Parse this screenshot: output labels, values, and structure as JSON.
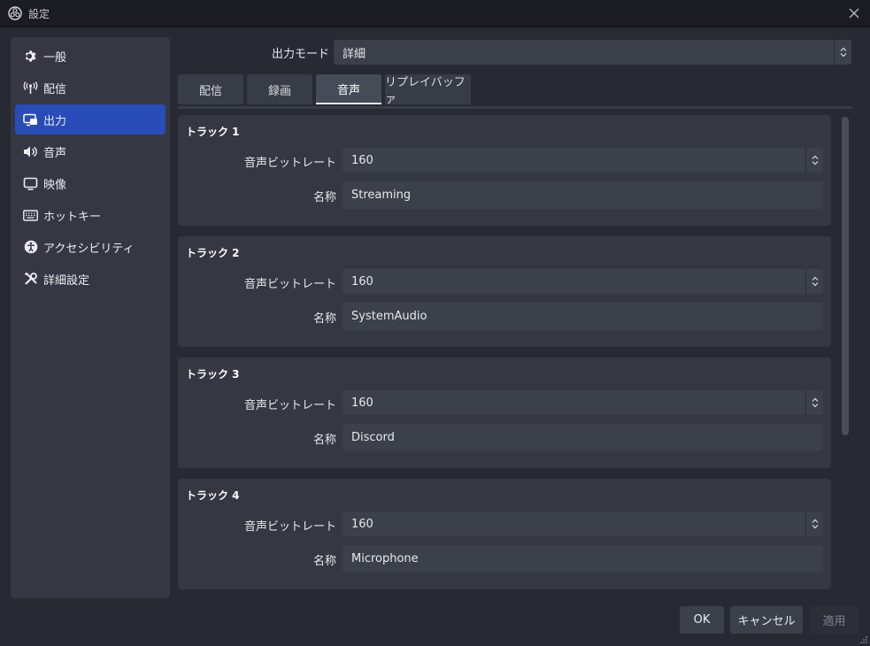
{
  "window": {
    "title": "設定"
  },
  "sidebar": {
    "items": [
      {
        "label": "一般",
        "icon": "gear-icon",
        "active": false
      },
      {
        "label": "配信",
        "icon": "broadcast-icon",
        "active": false
      },
      {
        "label": "出力",
        "icon": "output-icon",
        "active": true
      },
      {
        "label": "音声",
        "icon": "speaker-icon",
        "active": false
      },
      {
        "label": "映像",
        "icon": "monitor-icon",
        "active": false
      },
      {
        "label": "ホットキー",
        "icon": "keyboard-icon",
        "active": false
      },
      {
        "label": "アクセシビリティ",
        "icon": "accessibility-icon",
        "active": false
      },
      {
        "label": "詳細設定",
        "icon": "tools-icon",
        "active": false
      }
    ]
  },
  "output_mode": {
    "label": "出力モード",
    "value": "詳細"
  },
  "tabs": [
    {
      "label": "配信",
      "active": false
    },
    {
      "label": "録画",
      "active": false
    },
    {
      "label": "音声",
      "active": true
    },
    {
      "label": "リプレイバッファ",
      "active": false
    }
  ],
  "tracks": [
    {
      "title": "トラック 1",
      "bitrate_label": "音声ビットレート",
      "bitrate": "160",
      "name_label": "名称",
      "name": "Streaming"
    },
    {
      "title": "トラック 2",
      "bitrate_label": "音声ビットレート",
      "bitrate": "160",
      "name_label": "名称",
      "name": "SystemAudio"
    },
    {
      "title": "トラック 3",
      "bitrate_label": "音声ビットレート",
      "bitrate": "160",
      "name_label": "名称",
      "name": "Discord"
    },
    {
      "title": "トラック 4",
      "bitrate_label": "音声ビットレート",
      "bitrate": "160",
      "name_label": "名称",
      "name": "Microphone"
    }
  ],
  "footer": {
    "ok": "OK",
    "cancel": "キャンセル",
    "apply": "適用"
  },
  "colors": {
    "accent": "#284cb8",
    "panel": "#353843",
    "input": "#3c404b",
    "background": "#272a33"
  }
}
